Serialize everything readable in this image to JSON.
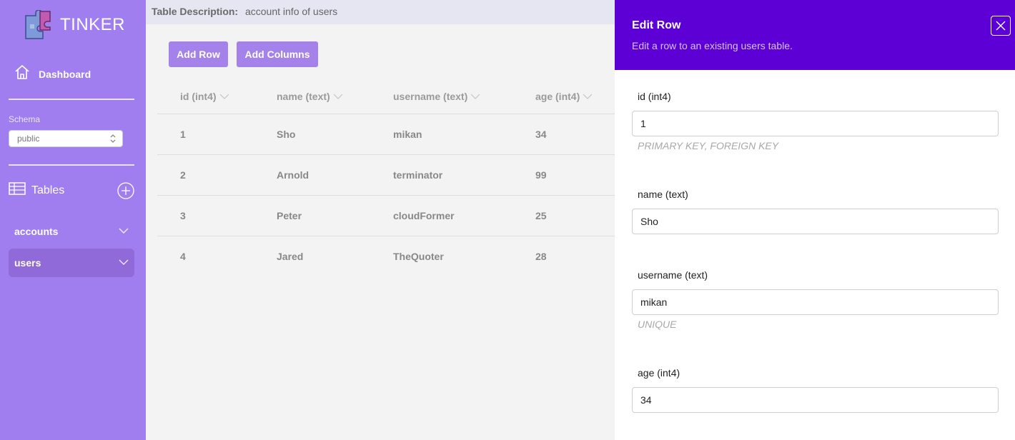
{
  "app": {
    "name": "TINKER"
  },
  "sidebar": {
    "dashboard_label": "Dashboard",
    "schema_label": "Schema",
    "schema_value": "public",
    "tables_label": "Tables",
    "tables": [
      {
        "label": "accounts",
        "active": false
      },
      {
        "label": "users",
        "active": true
      }
    ]
  },
  "main": {
    "description_label": "Table Description:",
    "description_value": "account info of users",
    "add_row_label": "Add Row",
    "add_columns_label": "Add Columns",
    "columns": [
      "id (int4)",
      "name (text)",
      "username (text)",
      "age (int4)"
    ],
    "rows": [
      [
        "1",
        "Sho",
        "mikan",
        "34"
      ],
      [
        "2",
        "Arnold",
        "terminator",
        "99"
      ],
      [
        "3",
        "Peter",
        "cloudFormer",
        "25"
      ],
      [
        "4",
        "Jared",
        "TheQuoter",
        "28"
      ]
    ]
  },
  "panel": {
    "title": "Edit Row",
    "subtitle": "Edit a row to an existing users table.",
    "fields": [
      {
        "label": "id (int4)",
        "value": "1",
        "hint": "PRIMARY KEY, FOREIGN KEY"
      },
      {
        "label": "name (text)",
        "value": "Sho",
        "hint": ""
      },
      {
        "label": "username (text)",
        "value": "mikan",
        "hint": "UNIQUE"
      },
      {
        "label": "age (int4)",
        "value": "34",
        "hint": ""
      }
    ]
  },
  "colors": {
    "sidebar_bg": "#a07ef0",
    "panel_header_bg": "#5c00d6",
    "button_bg": "#a581ea"
  },
  "icons": [
    "puzzle-logo-icon",
    "home-icon",
    "chevron-updown-icon",
    "table-icon",
    "plus-circle-icon",
    "chevron-down-icon",
    "sort-chevron-icon",
    "close-icon"
  ]
}
